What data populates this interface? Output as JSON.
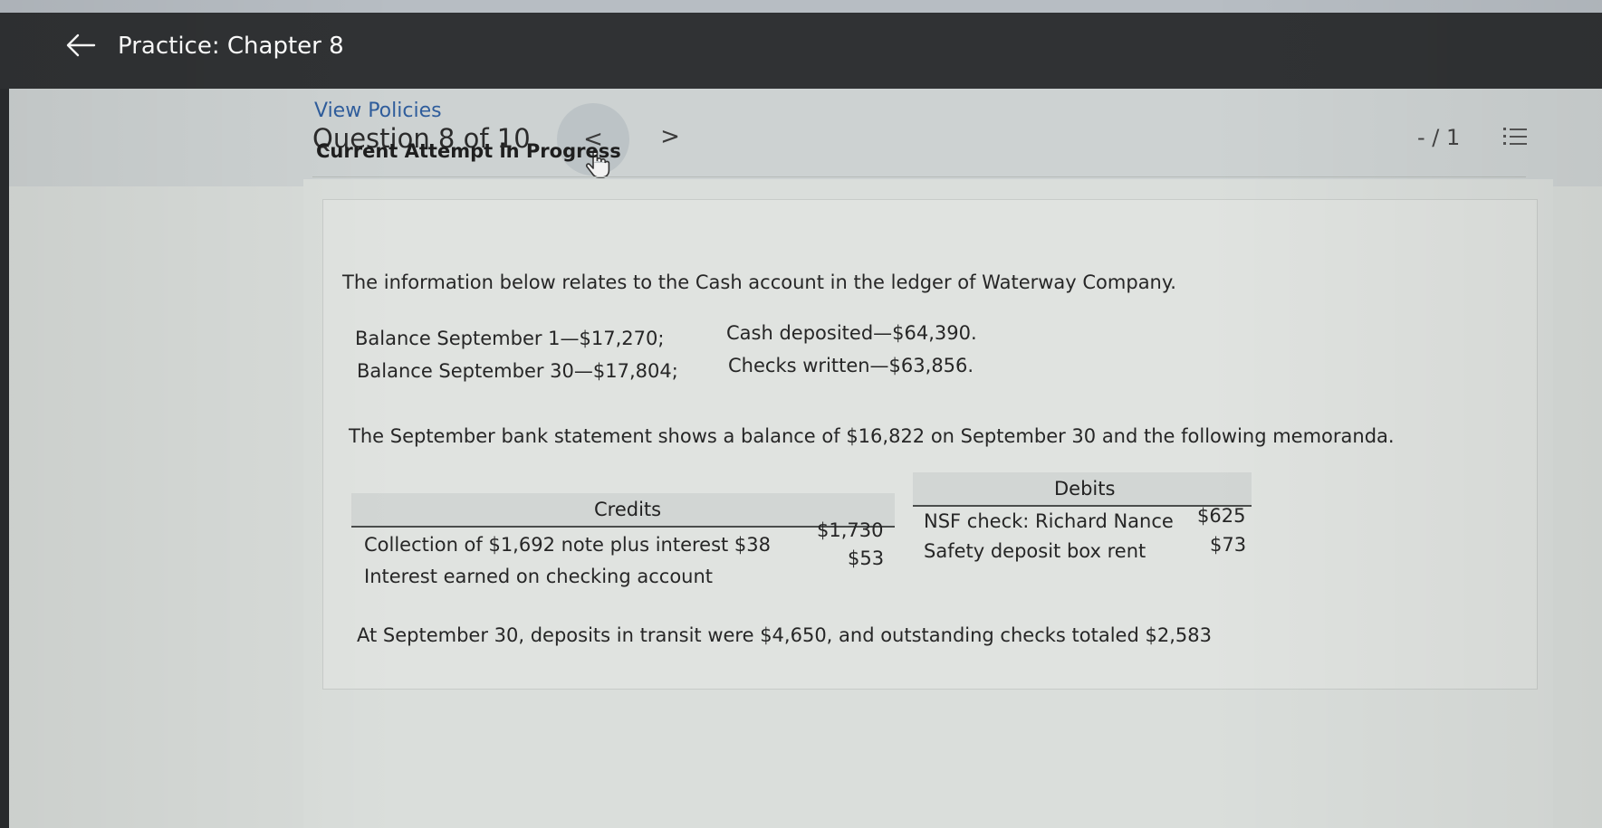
{
  "topbar": {
    "title": "Practice: Chapter 8",
    "back_icon": "arrow-left-icon"
  },
  "question_header": {
    "title": "Question 8 of 10",
    "prev_label": "<",
    "next_label": ">",
    "score": "- / 1",
    "list_icon": "list-icon"
  },
  "links": {
    "view_policies": "View Policies"
  },
  "attempt": {
    "label": "Current Attempt in Progress"
  },
  "problem": {
    "intro": "The information below relates to the Cash account in the ledger of Waterway Company.",
    "balance_sep1": "Balance September 1—$17,270;",
    "cash_deposited": "Cash deposited—$64,390.",
    "balance_sep30": "Balance September 30—$17,804;",
    "checks_written": "Checks written—$63,856.",
    "bank_statement": "The September bank statement shows a balance of $16,822 on September 30 and the following memoranda.",
    "credits_header": "Credits",
    "debits_header": "Debits",
    "credits": [
      {
        "label": "Collection of $1,692 note plus interest $38",
        "amount": "$1,730"
      },
      {
        "label": "Interest earned on checking account",
        "amount": "$53"
      }
    ],
    "debits": [
      {
        "label": "NSF check: Richard Nance",
        "amount": "$625"
      },
      {
        "label": "Safety deposit box rent",
        "amount": "$73"
      }
    ],
    "transit": "At September 30, deposits in transit were $4,650, and outstanding checks totaled $2,583"
  }
}
